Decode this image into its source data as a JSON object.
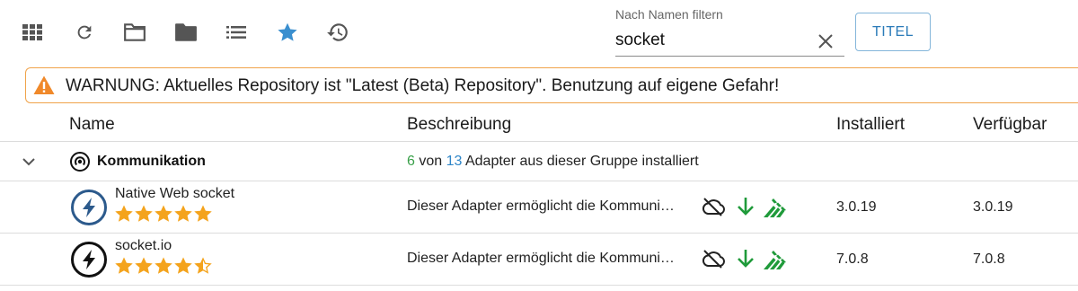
{
  "toolbar": {
    "icons": [
      "grid-icon",
      "refresh-icon",
      "folder-outline-icon",
      "folder-filled-icon",
      "list-icon",
      "star-icon",
      "update-history-icon"
    ],
    "accent": "#3a8fcf"
  },
  "filter": {
    "label": "Nach Namen filtern",
    "value": "socket"
  },
  "title_button": {
    "label": "TITEL"
  },
  "warning": {
    "text": "WARNUNG: Aktuelles Repository ist \"Latest (Beta) Repository\". Benutzung auf eigene Gefahr!",
    "color": "#f0892a"
  },
  "table": {
    "headers": {
      "name": "Name",
      "description": "Beschreibung",
      "installed": "Installiert",
      "available": "Verfügbar"
    },
    "group": {
      "name": "Kommunikation",
      "installed_count": "6",
      "of_text": "von",
      "total_count": "13",
      "suffix": "Adapter aus dieser Gruppe installiert"
    },
    "adapters": [
      {
        "name": "Native Web socket",
        "rating": 5,
        "description": "Dieser Adapter ermöglicht die Kommuni…",
        "installed": "3.0.19",
        "available": "3.0.19",
        "logo_color": "#2c5a8c"
      },
      {
        "name": "socket.io",
        "rating": 4.5,
        "description": "Dieser Adapter ermöglicht die Kommuni…",
        "installed": "7.0.8",
        "available": "7.0.8",
        "logo_color": "#111111"
      }
    ],
    "row_icons": [
      "cloud-off-icon",
      "download-arrow-icon",
      "installed-stats-icon"
    ],
    "icon_green": "#1f9a3a",
    "star_color": "#f4a31c"
  }
}
